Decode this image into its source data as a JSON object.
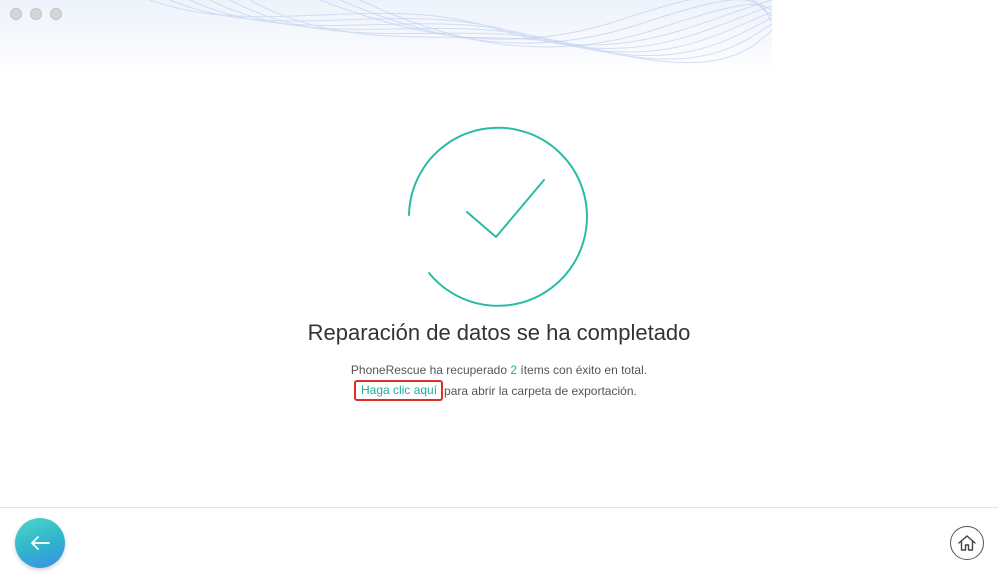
{
  "window": {
    "traffic_lights": [
      "close",
      "minimize",
      "zoom"
    ]
  },
  "result": {
    "title": "Reparación de datos se ha completado",
    "line1_prefix": "PhoneRescue ha recuperado ",
    "item_count": "2",
    "line1_suffix": " ítems con éxito en total.",
    "link_label": "Haga clic aquí",
    "line2_suffix": "para abrir la carpeta de exportación."
  },
  "footer": {
    "back_icon": "arrow-left-icon",
    "home_icon": "home-icon"
  },
  "colors": {
    "accent": "#1fae9b",
    "highlight_border": "#d9302c",
    "back_gradient_start": "#4fd6c8",
    "back_gradient_end": "#3a8fe6"
  }
}
